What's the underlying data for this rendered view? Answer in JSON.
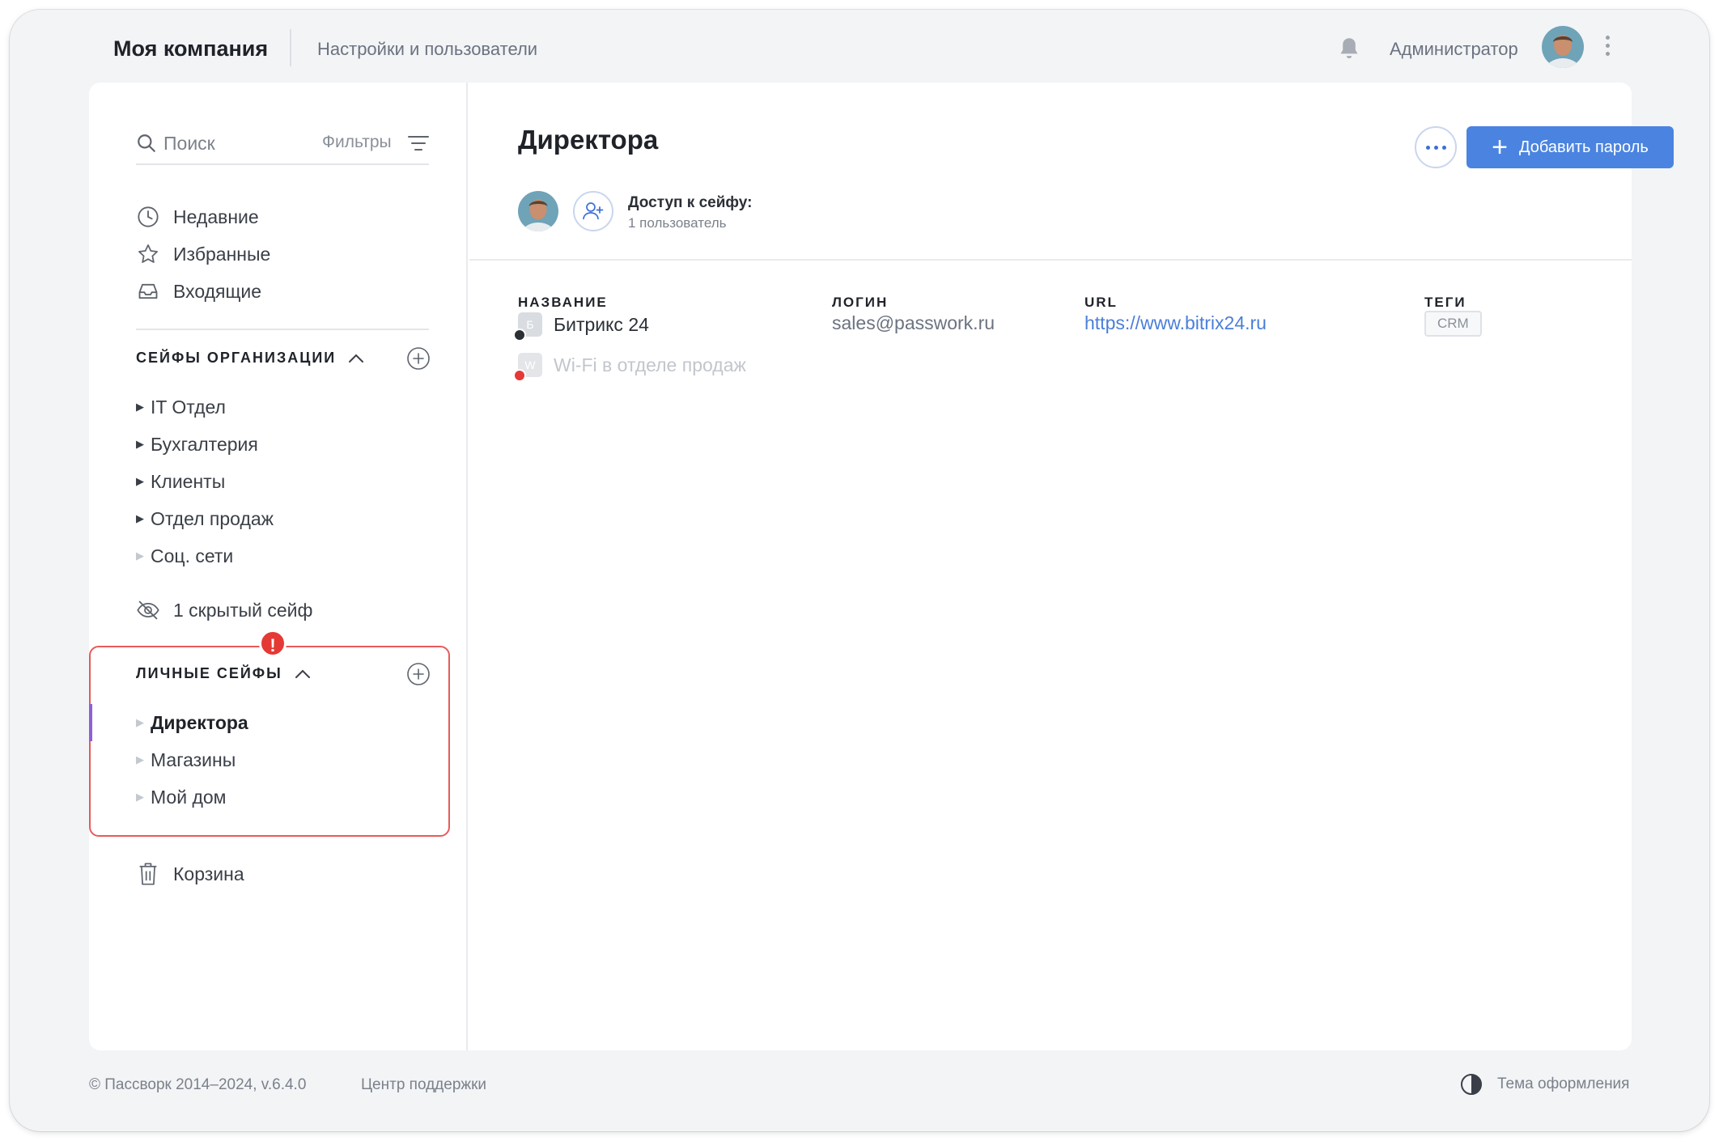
{
  "header": {
    "company": "Моя компания",
    "section": "Настройки и пользователи",
    "user_name": "Администратор"
  },
  "sidebar": {
    "search_placeholder": "Поиск",
    "filters_label": "Фильтры",
    "nav": [
      {
        "label": "Недавние",
        "icon": "clock-icon"
      },
      {
        "label": "Избранные",
        "icon": "star-icon"
      },
      {
        "label": "Входящие",
        "icon": "inbox-icon"
      }
    ],
    "org_title": "СЕЙФЫ ОРГАНИЗАЦИИ",
    "org_vaults": [
      "IT Отдел",
      "Бухгалтерия",
      "Клиенты",
      "Отдел продаж",
      "Соц. сети"
    ],
    "hidden_label": "1 скрытый сейф",
    "personal_title": "ЛИЧНЫЕ СЕЙФЫ",
    "personal_alert": "!",
    "personal_vaults": [
      "Директора",
      "Магазины",
      "Мой дом"
    ],
    "trash_label": "Корзина"
  },
  "main": {
    "title": "Директора",
    "add_label": "Добавить пароль",
    "access_title": "Доступ к сейфу:",
    "access_sub": "1 пользователь",
    "columns": {
      "name": "НАЗВАНИЕ",
      "login": "ЛОГИН",
      "url": "URL",
      "tags": "ТЕГИ"
    },
    "rows": [
      {
        "initial": "Б",
        "name": "Битрикс 24",
        "login": "sales@passwork.ru",
        "url": "https://www.bitrix24.ru",
        "tag": "CRM",
        "badge_color": "#2b2f36"
      },
      {
        "initial": "W",
        "name": "Wi-Fi в отделе продаж",
        "login": "",
        "url": "",
        "tag": "",
        "badge_color": "#e53935"
      }
    ]
  },
  "footer": {
    "copyright": "© Пассворк 2014–2024, v.6.4.0",
    "support": "Центр поддержки",
    "theme": "Тема оформления"
  },
  "colors": {
    "accent": "#4a84e0",
    "alert": "#e53935",
    "link": "#4a7fd8"
  }
}
